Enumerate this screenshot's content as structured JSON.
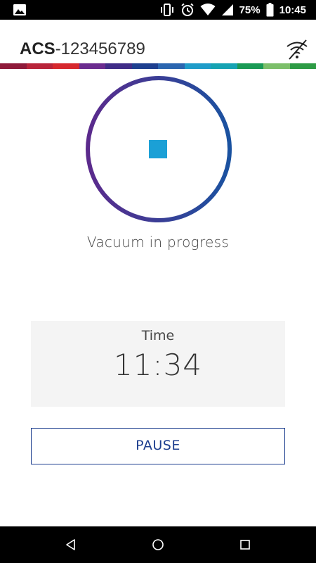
{
  "status_bar": {
    "battery_percent": "75%",
    "time": "10:45",
    "icons": [
      "image-icon",
      "vibrate-icon",
      "alarm-icon",
      "wifi-icon",
      "cell-signal-icon",
      "battery-icon"
    ]
  },
  "header": {
    "title_prefix": "ACS",
    "title_serial": "-123456789",
    "wifi_status_icon": "wifi-off-icon"
  },
  "brand_stripe_colors": [
    "#8e1a3a",
    "#b8243a",
    "#d6282e",
    "#6b2c8f",
    "#3f2c87",
    "#1e3f8f",
    "#2b66b0",
    "#1f9cc9",
    "#16a3b3",
    "#1a9a55",
    "#7cbf6a",
    "#2d9b45"
  ],
  "progress": {
    "ring_gradient": [
      "#5b2a8c",
      "#1a52a0"
    ],
    "stop_button_color": "#1ba0d6",
    "status_text": "Vacuum in progress"
  },
  "timer": {
    "label": "Time",
    "value": "11:34"
  },
  "actions": {
    "pause_label": "PAUSE"
  },
  "nav_bar": {
    "icons": [
      "back-icon",
      "home-icon",
      "recents-icon"
    ]
  }
}
